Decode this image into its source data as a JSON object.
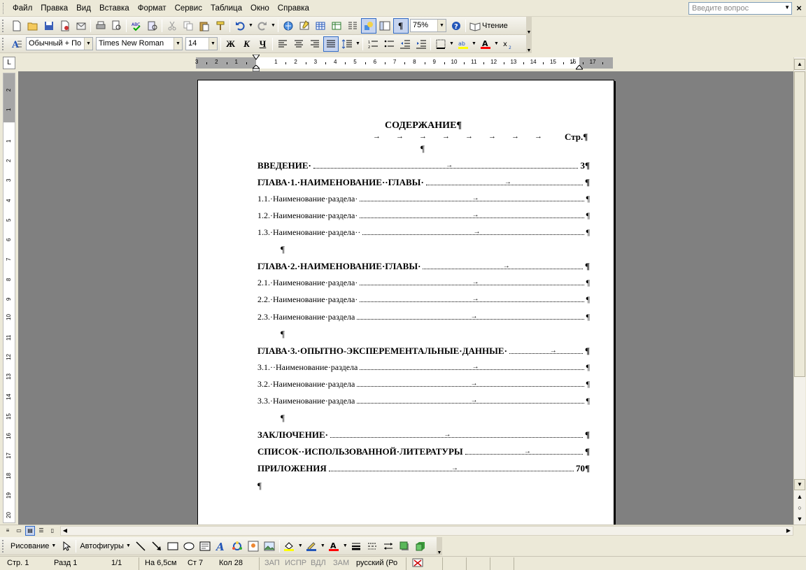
{
  "menu": {
    "items": [
      "Файл",
      "Правка",
      "Вид",
      "Вставка",
      "Формат",
      "Сервис",
      "Таблица",
      "Окно",
      "Справка"
    ],
    "ask_placeholder": "Введите вопрос",
    "close_symbol": "×"
  },
  "toolbar_standard": {
    "zoom": "75%",
    "reading_label": "Чтение"
  },
  "toolbar_format": {
    "style": "Обычный + По ц",
    "font": "Times New Roman",
    "size": "14",
    "bold": "Ж",
    "italic": "К",
    "underline": "Ч"
  },
  "ruler": {
    "tab_selector": "L",
    "numbers": [
      "3",
      "2",
      "1",
      "1",
      "2",
      "3",
      "4",
      "5",
      "6",
      "7",
      "8",
      "9",
      "10",
      "11",
      "12",
      "13",
      "14",
      "15",
      "16",
      "17"
    ],
    "v_numbers": [
      "2",
      "1",
      "1",
      "2",
      "3",
      "4",
      "5",
      "6",
      "7",
      "8",
      "9",
      "10",
      "11",
      "12",
      "13",
      "14",
      "15",
      "16",
      "17",
      "18",
      "19",
      "20"
    ]
  },
  "document": {
    "title": "СОДЕРЖАНИЕ¶",
    "page_header": "Стр.¶",
    "blank_mark": "¶",
    "entries": [
      {
        "label": "ВВЕДЕНИЕ·",
        "page": "3¶",
        "bold": true
      },
      {
        "label": "ГЛАВА·1.·НАИМЕНОВАНИЕ··ГЛАВЫ·",
        "page": "¶",
        "bold": true
      },
      {
        "label": "1.1.·Наименование·раздела·",
        "page": "¶",
        "bold": false
      },
      {
        "label": "1.2.·Наименование·раздела·",
        "page": "¶",
        "bold": false
      },
      {
        "label": "1.3.·Наименование·раздела··",
        "page": "¶",
        "bold": false
      },
      {
        "label": "ГЛАВА·2.·НАИМЕНОВАНИЕ·ГЛАВЫ·",
        "page": "¶",
        "bold": true
      },
      {
        "label": "2.1.·Наименование·раздела·",
        "page": "¶",
        "bold": false
      },
      {
        "label": "2.2.·Наименование·раздела·",
        "page": "¶",
        "bold": false
      },
      {
        "label": "2.3.·Наименование·раздела",
        "page": "¶",
        "bold": false
      },
      {
        "label": "ГЛАВА·3.·ОПЫТНО-ЭКСПЕРЕМЕНТАЛЬНЫЕ·ДАННЫЕ·",
        "page": "¶",
        "bold": true
      },
      {
        "label": "3.1.··Наименование·раздела",
        "page": "¶",
        "bold": false
      },
      {
        "label": "3.2.·Наименование·раздела",
        "page": "¶",
        "bold": false
      },
      {
        "label": "3.3.·Наименование·раздела",
        "page": "¶",
        "bold": false
      },
      {
        "label": "ЗАКЛЮЧЕНИЕ·",
        "page": "¶",
        "bold": true
      },
      {
        "label": "СПИСОК··ИСПОЛЬЗОВАННОЙ·ЛИТЕРАТУРЫ",
        "page": "¶",
        "bold": true
      },
      {
        "label": "ПРИЛОЖЕНИЯ",
        "page": "70¶",
        "bold": true
      }
    ]
  },
  "toolbar_draw": {
    "drawing_label": "Рисование",
    "autoshapes_label": "Автофигуры"
  },
  "status": {
    "page": "Стр. 1",
    "section": "Разд 1",
    "page_of": "1/1",
    "at": "На 6,5см",
    "line": "Ст 7",
    "column": "Кол 28",
    "rec": "ЗАП",
    "trk": "ИСПР",
    "ext": "ВДЛ",
    "ovr": "ЗАМ",
    "language": "русский (Ро"
  }
}
